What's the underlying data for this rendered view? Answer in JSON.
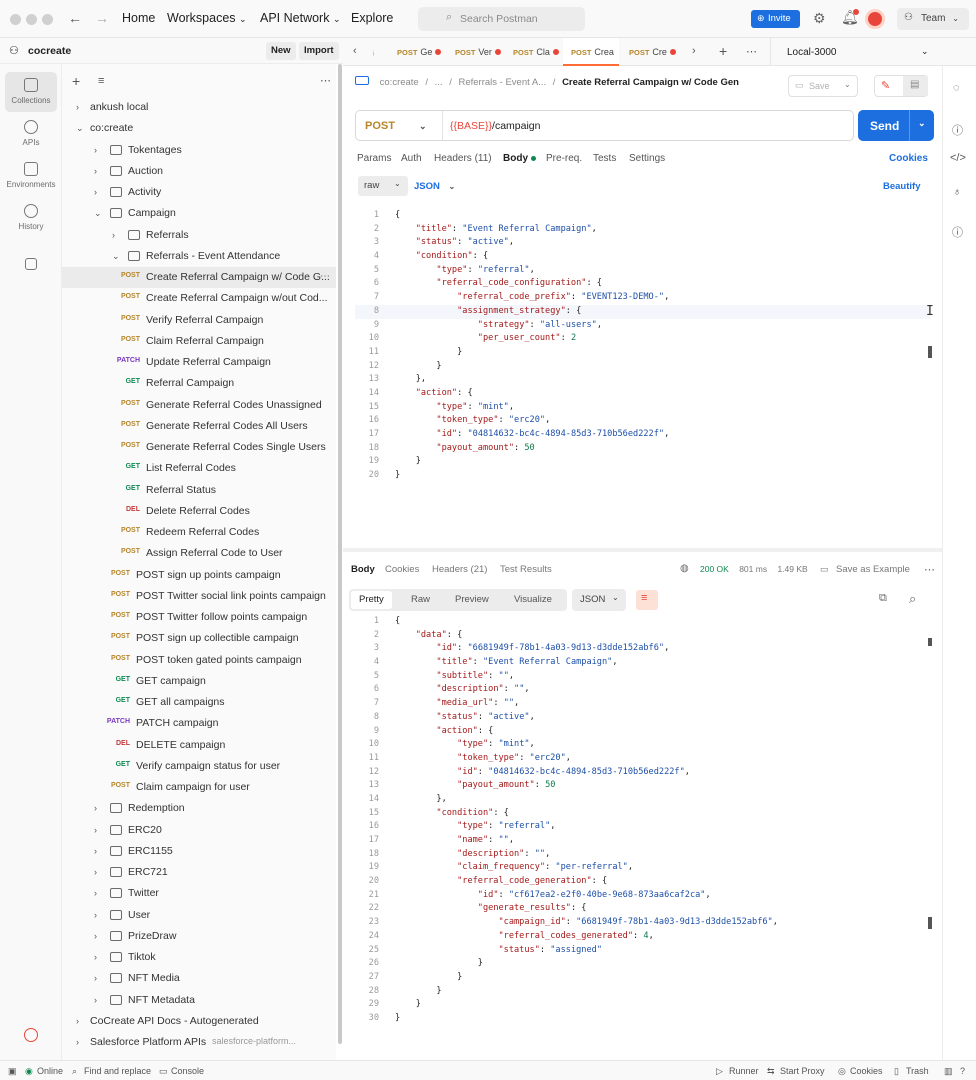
{
  "topbar": {
    "nav": [
      "Home",
      "Workspaces",
      "API Network",
      "Explore"
    ],
    "search_placeholder": "Search Postman",
    "invite_label": "Invite",
    "team_label": "Team"
  },
  "sidebar": {
    "workspace": "cocreate",
    "new_label": "New",
    "import_label": "Import",
    "rail": [
      "Collections",
      "APIs",
      "Environments",
      "History"
    ],
    "rows": [
      {
        "label": "ankush local",
        "depth": 0,
        "kind": "collection",
        "chev": "right"
      },
      {
        "label": "co:create",
        "depth": 0,
        "kind": "collection",
        "chev": "down"
      },
      {
        "label": "Tokentages",
        "depth": 1,
        "kind": "folder",
        "chev": "right"
      },
      {
        "label": "Auction",
        "depth": 1,
        "kind": "folder",
        "chev": "right"
      },
      {
        "label": "Activity",
        "depth": 1,
        "kind": "folder",
        "chev": "right"
      },
      {
        "label": "Campaign",
        "depth": 1,
        "kind": "folder",
        "chev": "down"
      },
      {
        "label": "Referrals",
        "depth": 2,
        "kind": "folder",
        "chev": "right"
      },
      {
        "label": "Referrals - Event Attendance",
        "depth": 2,
        "kind": "folder",
        "chev": "down"
      },
      {
        "label": "Create Referral Campaign w/ Code G...",
        "depth": 3,
        "kind": "request",
        "method": "POST",
        "selected": true
      },
      {
        "label": "Create Referral Campaign w/out Cod...",
        "depth": 3,
        "kind": "request",
        "method": "POST"
      },
      {
        "label": "Verify Referral Campaign",
        "depth": 3,
        "kind": "request",
        "method": "POST"
      },
      {
        "label": "Claim Referral Campaign",
        "depth": 3,
        "kind": "request",
        "method": "POST"
      },
      {
        "label": "Update Referral Campaign",
        "depth": 3,
        "kind": "request",
        "method": "PATCH"
      },
      {
        "label": "Referral Campaign",
        "depth": 3,
        "kind": "request",
        "method": "GET"
      },
      {
        "label": "Generate Referral Codes Unassigned",
        "depth": 3,
        "kind": "request",
        "method": "POST"
      },
      {
        "label": "Generate Referral Codes All Users",
        "depth": 3,
        "kind": "request",
        "method": "POST"
      },
      {
        "label": "Generate Referral Codes Single Users",
        "depth": 3,
        "kind": "request",
        "method": "POST"
      },
      {
        "label": "List Referral Codes",
        "depth": 3,
        "kind": "request",
        "method": "GET"
      },
      {
        "label": "Referral Status",
        "depth": 3,
        "kind": "request",
        "method": "GET"
      },
      {
        "label": "Delete Referral Codes",
        "depth": 3,
        "kind": "request",
        "method": "DEL"
      },
      {
        "label": "Redeem Referral Codes",
        "depth": 3,
        "kind": "request",
        "method": "POST"
      },
      {
        "label": "Assign Referral Code to User",
        "depth": 3,
        "kind": "request",
        "method": "POST"
      },
      {
        "label": "POST sign up points campaign",
        "depth": 2,
        "kind": "request",
        "method": "POST"
      },
      {
        "label": "POST Twitter social link points campaign",
        "depth": 2,
        "kind": "request",
        "method": "POST"
      },
      {
        "label": "POST Twitter follow points campaign",
        "depth": 2,
        "kind": "request",
        "method": "POST"
      },
      {
        "label": "POST sign up collectible campaign",
        "depth": 2,
        "kind": "request",
        "method": "POST"
      },
      {
        "label": "POST token gated points campaign",
        "depth": 2,
        "kind": "request",
        "method": "POST"
      },
      {
        "label": "GET campaign",
        "depth": 2,
        "kind": "request",
        "method": "GET"
      },
      {
        "label": "GET all campaigns",
        "depth": 2,
        "kind": "request",
        "method": "GET"
      },
      {
        "label": "PATCH campaign",
        "depth": 2,
        "kind": "request",
        "method": "PATCH"
      },
      {
        "label": "DELETE campaign",
        "depth": 2,
        "kind": "request",
        "method": "DEL"
      },
      {
        "label": "Verify campaign status for user",
        "depth": 2,
        "kind": "request",
        "method": "GET"
      },
      {
        "label": "Claim campaign for user",
        "depth": 2,
        "kind": "request",
        "method": "POST"
      },
      {
        "label": "Redemption",
        "depth": 1,
        "kind": "folder",
        "chev": "right"
      },
      {
        "label": "ERC20",
        "depth": 1,
        "kind": "folder",
        "chev": "right"
      },
      {
        "label": "ERC1155",
        "depth": 1,
        "kind": "folder",
        "chev": "right"
      },
      {
        "label": "ERC721",
        "depth": 1,
        "kind": "folder",
        "chev": "right"
      },
      {
        "label": "Twitter",
        "depth": 1,
        "kind": "folder",
        "chev": "right"
      },
      {
        "label": "User",
        "depth": 1,
        "kind": "folder",
        "chev": "right"
      },
      {
        "label": "PrizeDraw",
        "depth": 1,
        "kind": "folder",
        "chev": "right"
      },
      {
        "label": "Tiktok",
        "depth": 1,
        "kind": "folder",
        "chev": "right"
      },
      {
        "label": "NFT Media",
        "depth": 1,
        "kind": "folder",
        "chev": "right"
      },
      {
        "label": "NFT Metadata",
        "depth": 1,
        "kind": "folder",
        "chev": "right"
      },
      {
        "label": "CoCreate API Docs - Autogenerated",
        "depth": 0,
        "kind": "collection",
        "chev": "right"
      },
      {
        "label": "Salesforce Platform APIs",
        "depth": 0,
        "kind": "collection",
        "chev": "right",
        "suffix": "salesforce-platform..."
      }
    ]
  },
  "tabs": [
    {
      "method": "POST",
      "label": "Ge",
      "dot": true
    },
    {
      "method": "POST",
      "label": "Ver",
      "dot": true
    },
    {
      "method": "POST",
      "label": "Cla",
      "dot": true
    },
    {
      "method": "POST",
      "label": "Crea",
      "dot": false,
      "active": true
    },
    {
      "method": "POST",
      "label": "Cre",
      "dot": true
    }
  ],
  "environment": "Local-3000",
  "request": {
    "breadcrumb_root": "co:create",
    "breadcrumb_mid": "Referrals - Event A...",
    "title": "Create Referral Campaign w/ Code Gen",
    "save_label": "Save",
    "method": "POST",
    "url_var": "{{BASE}}",
    "url_path": "/campaign",
    "send_label": "Send",
    "tabs": [
      "Params",
      "Auth",
      "Headers (11)",
      "Body",
      "Pre-req.",
      "Tests",
      "Settings"
    ],
    "cookies_label": "Cookies",
    "body_mode": "raw",
    "body_format": "JSON",
    "beautify_label": "Beautify",
    "body_lines": [
      "{",
      "    \"title\": \"Event Referral Campaign\",",
      "    \"status\": \"active\",",
      "    \"condition\": {",
      "        \"type\": \"referral\",",
      "        \"referral_code_configuration\": {",
      "            \"referral_code_prefix\": \"EVENT123-DEMO-\",",
      "            \"assignment_strategy\": {",
      "                \"strategy\": \"all-users\",",
      "                \"per_user_count\": 2",
      "            }",
      "        }",
      "    },",
      "    \"action\": {",
      "        \"type\": \"mint\",",
      "        \"token_type\": \"erc20\",",
      "        \"id\": \"04814632-bc4c-4894-85d3-710b56ed222f\",",
      "        \"payout_amount\": 50",
      "    }",
      "}"
    ]
  },
  "response": {
    "tabs": [
      "Body",
      "Cookies",
      "Headers (21)",
      "Test Results"
    ],
    "status": "200 OK",
    "time": "801 ms",
    "size": "1.49 KB",
    "save_example": "Save as Example",
    "views": [
      "Pretty",
      "Raw",
      "Preview",
      "Visualize"
    ],
    "format": "JSON",
    "body_lines": [
      "{",
      "    \"data\": {",
      "        \"id\": \"6681949f-78b1-4a03-9d13-d3dde152abf6\",",
      "        \"title\": \"Event Referral Campaign\",",
      "        \"subtitle\": \"\",",
      "        \"description\": \"\",",
      "        \"media_url\": \"\",",
      "        \"status\": \"active\",",
      "        \"action\": {",
      "            \"type\": \"mint\",",
      "            \"token_type\": \"erc20\",",
      "            \"id\": \"04814632-bc4c-4894-85d3-710b56ed222f\",",
      "            \"payout_amount\": 50",
      "        },",
      "        \"condition\": {",
      "            \"type\": \"referral\",",
      "            \"name\": \"\",",
      "            \"description\": \"\",",
      "            \"claim_frequency\": \"per-referral\",",
      "            \"referral_code_generation\": {",
      "                \"id\": \"cf617ea2-e2f0-40be-9e68-873aa6caf2ca\",",
      "                \"generate_results\": {",
      "                    \"campaign_id\": \"6681949f-78b1-4a03-9d13-d3dde152abf6\",",
      "                    \"referral_codes_generated\": 4,",
      "                    \"status\": \"assigned\"",
      "                }",
      "            }",
      "        }",
      "    }",
      "}"
    ]
  },
  "statusbar": {
    "online": "Online",
    "find": "Find and replace",
    "console": "Console",
    "runner": "Runner",
    "proxy": "Start Proxy",
    "cookies": "Cookies",
    "trash": "Trash"
  },
  "colors": {
    "accent": "#1d6fe0",
    "brand": "#ff6c37",
    "post": "#b6862a",
    "get": "#0e8a50",
    "patch": "#7a39c2",
    "del": "#c2393b"
  }
}
